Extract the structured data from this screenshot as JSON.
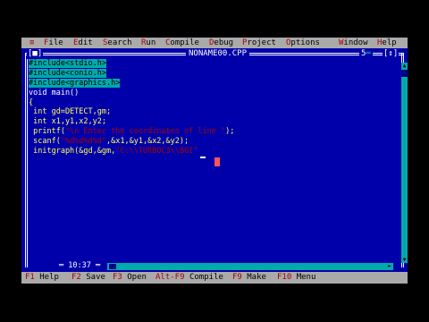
{
  "menu": {
    "system": "≡",
    "items": [
      {
        "hot": "F",
        "rest": "ile"
      },
      {
        "hot": "E",
        "rest": "dit"
      },
      {
        "hot": "S",
        "rest": "earch"
      },
      {
        "hot": "R",
        "rest": "un"
      },
      {
        "hot": "C",
        "rest": "ompile"
      },
      {
        "hot": "D",
        "rest": "ebug"
      },
      {
        "hot": "P",
        "rest": "roject"
      },
      {
        "hot": "O",
        "rest": "ptions"
      },
      {
        "hot": "W",
        "rest": "indow"
      },
      {
        "hot": "H",
        "rest": "elp"
      }
    ]
  },
  "window": {
    "title": "NONAME00.CPP",
    "close_box": "[■]",
    "number": "5",
    "zoom_box": "[↕]",
    "position": "10:37"
  },
  "code": {
    "lines": [
      {
        "parts": [
          {
            "t": "#include<stdio.h>",
            "c": "pre"
          }
        ]
      },
      {
        "parts": [
          {
            "t": "#include<conio.h>",
            "c": "pre"
          }
        ]
      },
      {
        "parts": [
          {
            "t": "#include<graphics.h>",
            "c": "pre"
          }
        ]
      },
      {
        "parts": [
          {
            "t": "void main()",
            "c": "kw"
          }
        ]
      },
      {
        "parts": [
          {
            "t": "{",
            "c": "tx"
          }
        ]
      },
      {
        "parts": [
          {
            "t": " int gd=DETECT,gm;",
            "c": "tx"
          }
        ]
      },
      {
        "parts": [
          {
            "t": " int x1,y1,x2,y2;",
            "c": "tx"
          }
        ]
      },
      {
        "parts": [
          {
            "t": " printf(",
            "c": "tx"
          },
          {
            "t": "\"\\n Enter the coordinates of line \"",
            "c": "str"
          },
          {
            "t": ");",
            "c": "tx"
          }
        ]
      },
      {
        "parts": [
          {
            "t": " scanf(",
            "c": "tx"
          },
          {
            "t": "\"%d%d%d%d\"",
            "c": "str"
          },
          {
            "t": ",&x1,&y1,&x2,&y2);",
            "c": "tx"
          }
        ]
      },
      {
        "parts": [
          {
            "t": " initgraph(&gd,&gm,",
            "c": "tx"
          },
          {
            "t": "\"C:\\\\TURBOC3\\\\BGI\"",
            "c": "str"
          }
        ]
      }
    ]
  },
  "function_bar": {
    "items": [
      {
        "key": "F1",
        "label": "Help"
      },
      {
        "key": "F2",
        "label": "Save"
      },
      {
        "key": "F3",
        "label": "Open"
      },
      {
        "key": "Alt-F9",
        "label": "Compile"
      },
      {
        "key": "F9",
        "label": "Make"
      },
      {
        "key": "F10",
        "label": "Menu"
      }
    ]
  },
  "colors": {
    "editor_bg": "#0000aa",
    "menu_bg": "#aaaaaa",
    "hotkey": "#aa0000",
    "preprocessor_bg": "#00aaaa",
    "text": "#ffff55"
  }
}
